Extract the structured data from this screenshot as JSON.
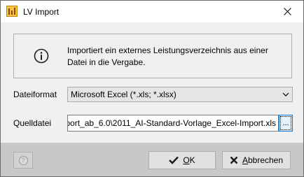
{
  "window": {
    "title": "LV Import"
  },
  "info": {
    "line1": "Importiert ein externes Leistungsverzeichnis aus einer",
    "line2": "Datei in die Vergabe."
  },
  "fields": {
    "format_label": "Dateiformat",
    "format_value": "Microsoft Excel (*.xls; *.xlsx)",
    "source_label": "Quelldatei",
    "source_value": "port_ab_6.0\\2011_AI-Standard-Vorlage_Excel-Import.xls",
    "browse_label": "..."
  },
  "buttons": {
    "ok_underlined": "O",
    "ok_rest": "K",
    "cancel_underlined": "A",
    "cancel_rest": "bbrechen"
  },
  "colors": {
    "accent": "#0078d7",
    "footer": "#c8c8c8",
    "panel": "#f0f0f0"
  }
}
